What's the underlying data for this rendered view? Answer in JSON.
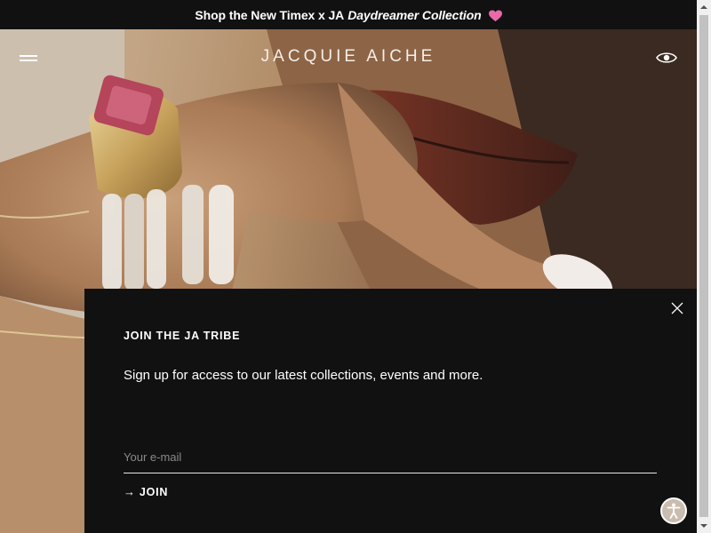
{
  "announcement": {
    "prefix": "Shop the New Timex x JA",
    "italic": "Daydreamer Collection",
    "heart_color": "#e86aa6"
  },
  "header": {
    "logo": "JACQUIE AICHE",
    "menu_icon": "hamburger-icon",
    "right_icon": "eye-icon"
  },
  "popup": {
    "title": "JOIN THE JA TRIBE",
    "text": "Sign up for access to our latest collections, events and more.",
    "email_placeholder": "Your e-mail",
    "join_arrow": "→",
    "join_label": "JOIN",
    "close_icon": "close-icon"
  },
  "accessibility": {
    "icon": "accessibility-icon"
  },
  "colors": {
    "background": "#111111",
    "accessibility_button": "#cabcae"
  }
}
